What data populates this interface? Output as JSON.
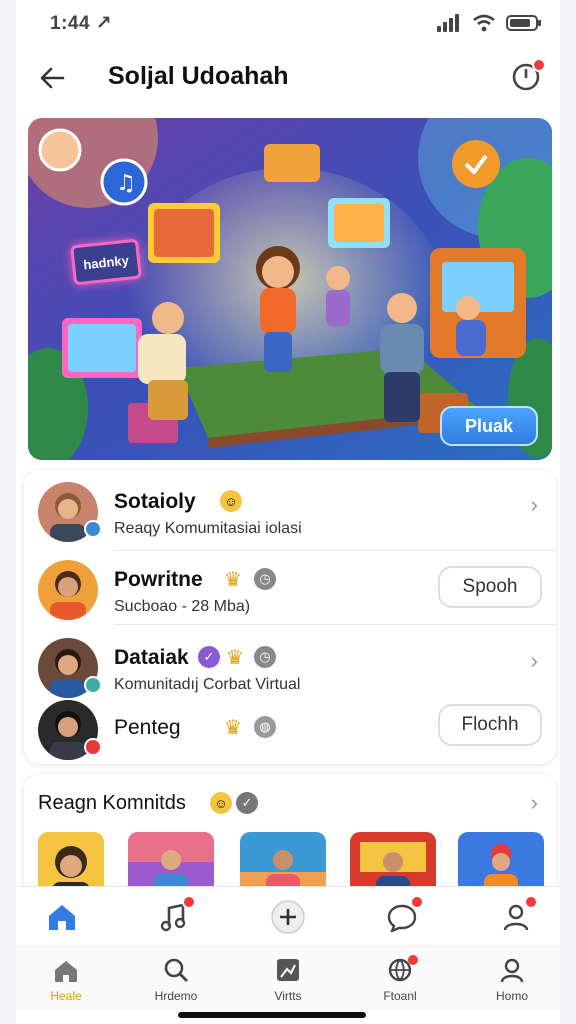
{
  "status_bar": {
    "time": "1:44 ↗"
  },
  "header": {
    "title": "Soljal Udoahah"
  },
  "hero": {
    "sign_text": "hadnky",
    "play_button": "Pluak"
  },
  "list": [
    {
      "name": "Sotaioly",
      "subtitle": "Reaqy Komumitasiai iolasi",
      "action": "chevron"
    },
    {
      "name": "Powritne",
      "subtitle": "Sucboao - 28 Mba)",
      "action": "Spooh"
    },
    {
      "name": "Dataiak",
      "subtitle": "Komunitadıj Corbat Virtual",
      "action": "chevron"
    },
    {
      "name": "Penteg",
      "subtitle": "",
      "action": "Flochh"
    }
  ],
  "communities": {
    "title": "Reagn Komnitds"
  },
  "tabs": [
    {
      "label": "Heale"
    },
    {
      "label": "Hrdemo"
    },
    {
      "label": "Virtts"
    },
    {
      "label": "Ftoanl"
    },
    {
      "label": "Homo"
    }
  ],
  "colors": {
    "accent": "#2f7de0",
    "notification": "#ef3b3b",
    "active_tab": "#d4a017"
  }
}
